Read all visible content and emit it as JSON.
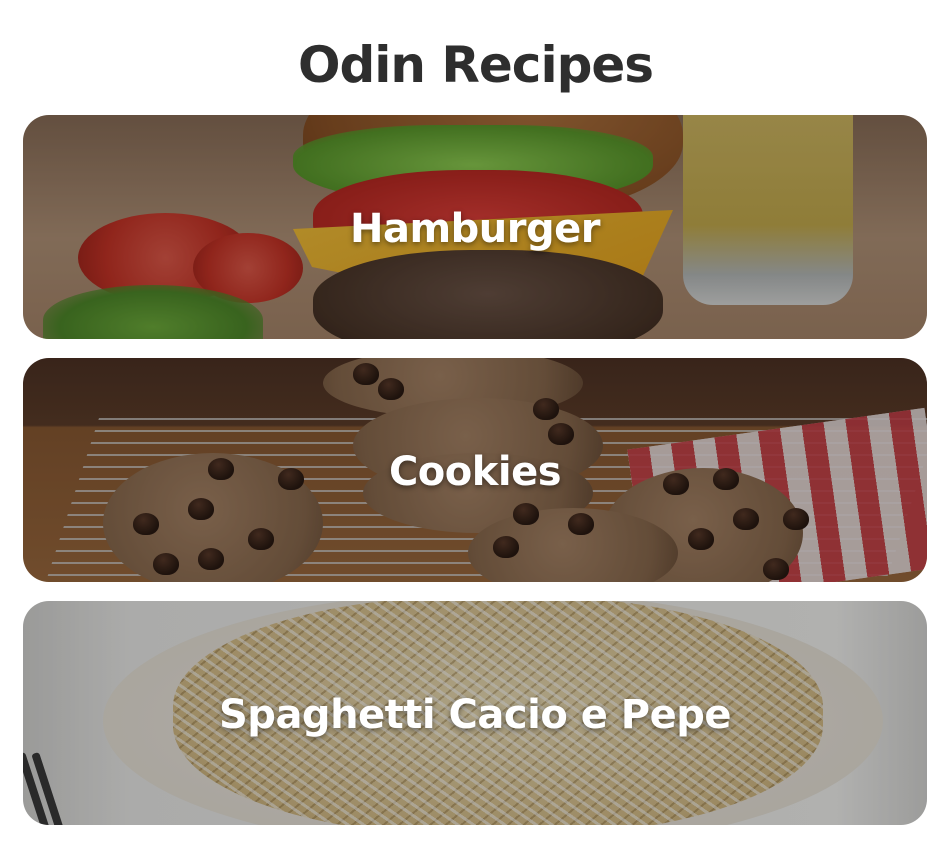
{
  "page": {
    "title": "Odin Recipes"
  },
  "recipes": [
    {
      "label": "Hamburger"
    },
    {
      "label": "Cookies"
    },
    {
      "label": "Spaghetti Cacio e Pepe"
    }
  ]
}
